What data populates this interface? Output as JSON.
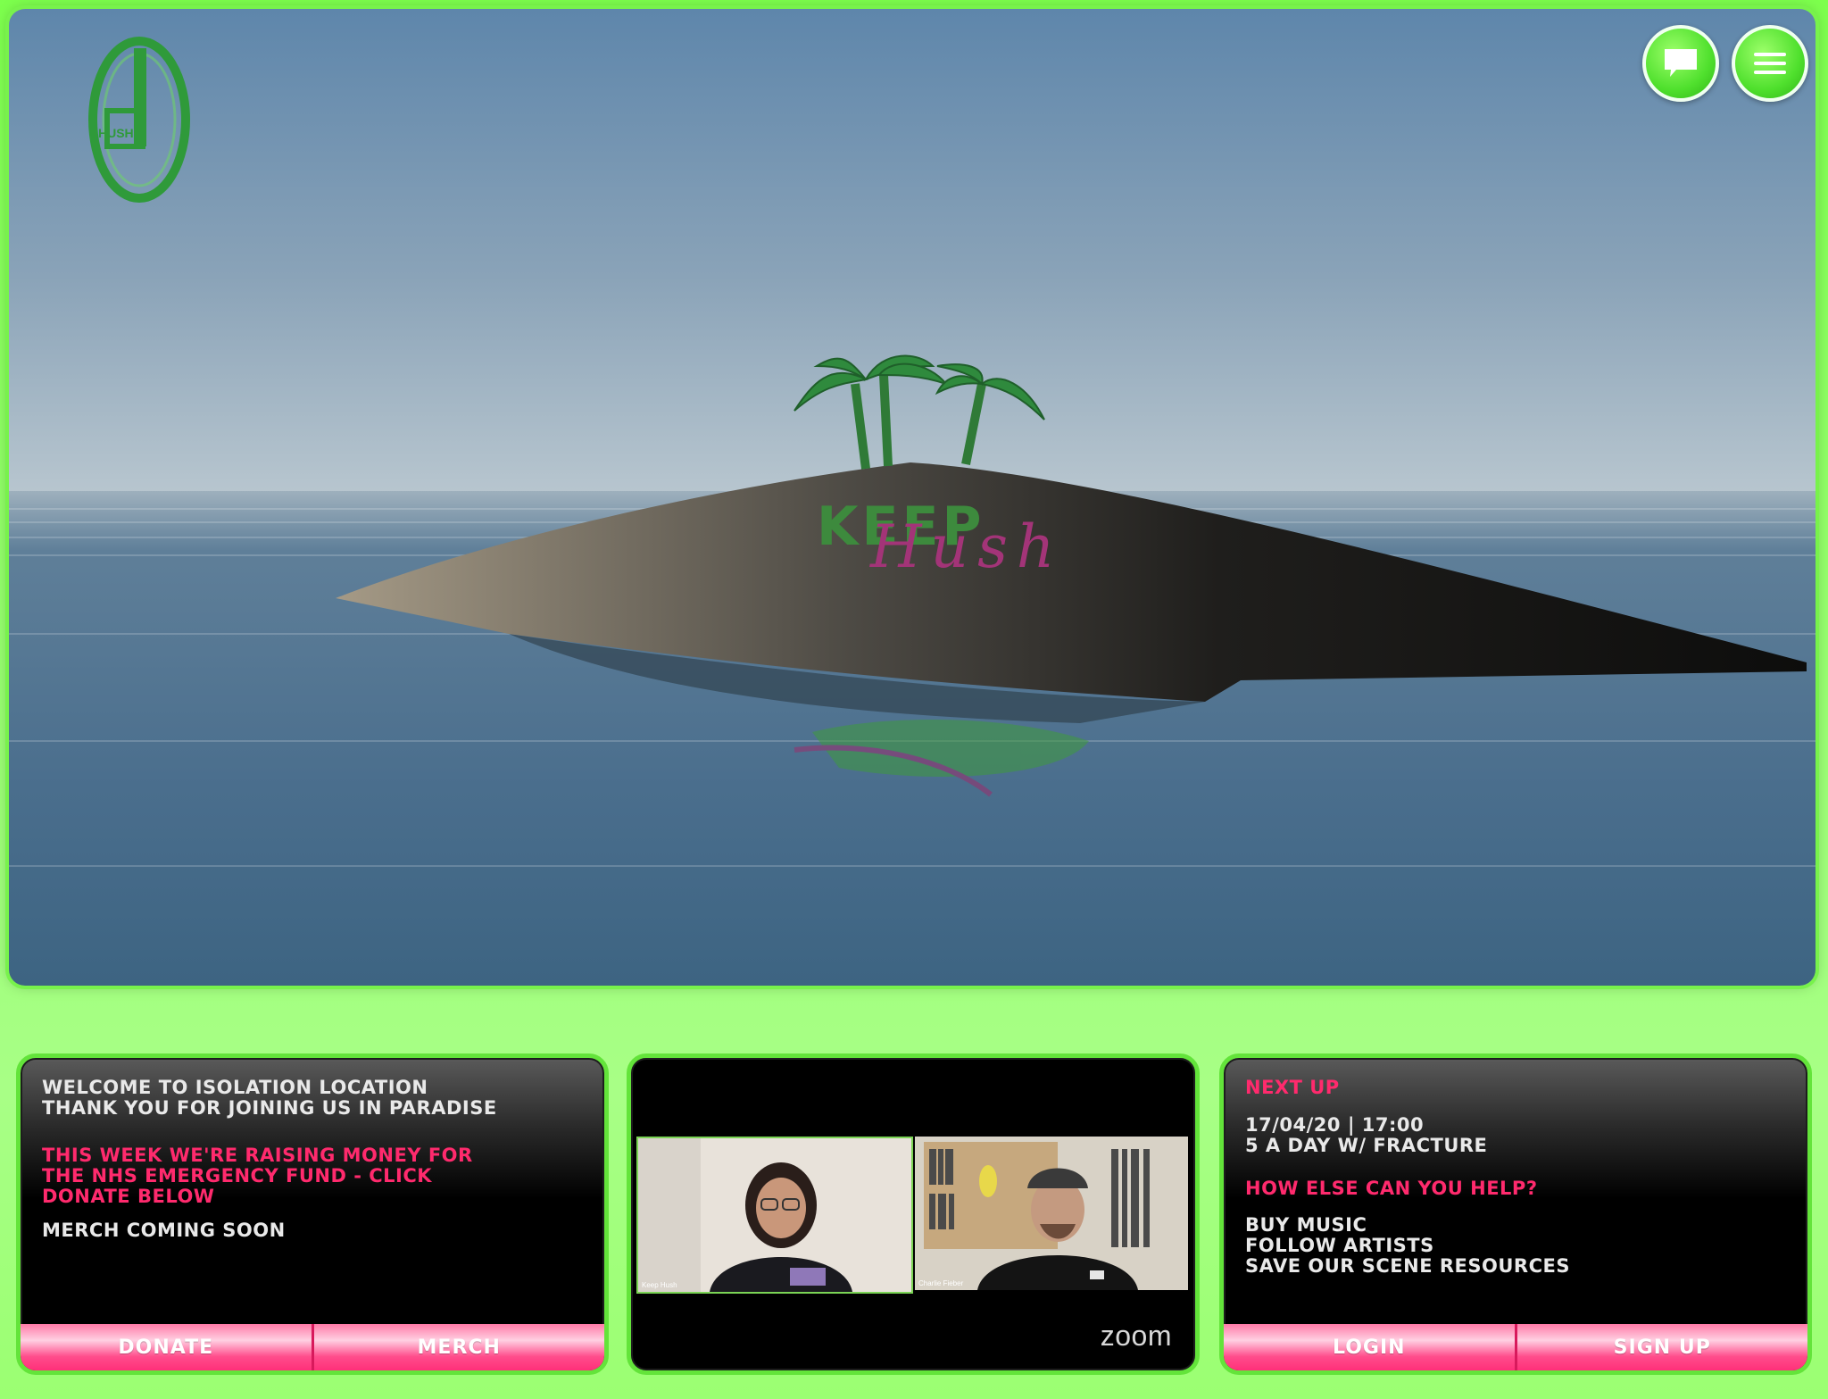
{
  "scene": {
    "island_logo_text": "KEEP",
    "island_logo_script": "Hush",
    "corner_logo_text": "HUSH"
  },
  "buttons": {
    "chat_icon": "speech-bubble-icon",
    "menu_icon": "hamburger-menu-icon"
  },
  "left_panel": {
    "welcome_line1": "WELCOME TO ISOLATION LOCATION",
    "welcome_line2": "THANK YOU FOR JOINING US IN PARADISE",
    "fund_line1": "THIS WEEK WE'RE RAISING MONEY FOR",
    "fund_line2": "THE NHS EMERGENCY FUND - CLICK",
    "fund_line3": "DONATE BELOW",
    "merch_text": "MERCH COMING SOON",
    "donate_label": "DONATE",
    "merch_label": "MERCH"
  },
  "middle_panel": {
    "participant1": "Keep Hush",
    "participant2": "Charlie Fieber",
    "brand": "zoom"
  },
  "right_panel": {
    "next_up_label": "NEXT UP",
    "event_datetime": "17/04/20 | 17:00",
    "event_title": "5 A DAY W/ FRACTURE",
    "help_heading": "HOW ELSE CAN YOU HELP?",
    "help_items": [
      "BUY MUSIC",
      "FOLLOW ARTISTS",
      "SAVE OUR SCENE RESOURCES"
    ],
    "login_label": "LOGIN",
    "signup_label": "SIGN UP"
  },
  "colors": {
    "frame_green": "#7dff4d",
    "accent_pink": "#ff2a6d",
    "button_pink": "#ff4d8c"
  }
}
